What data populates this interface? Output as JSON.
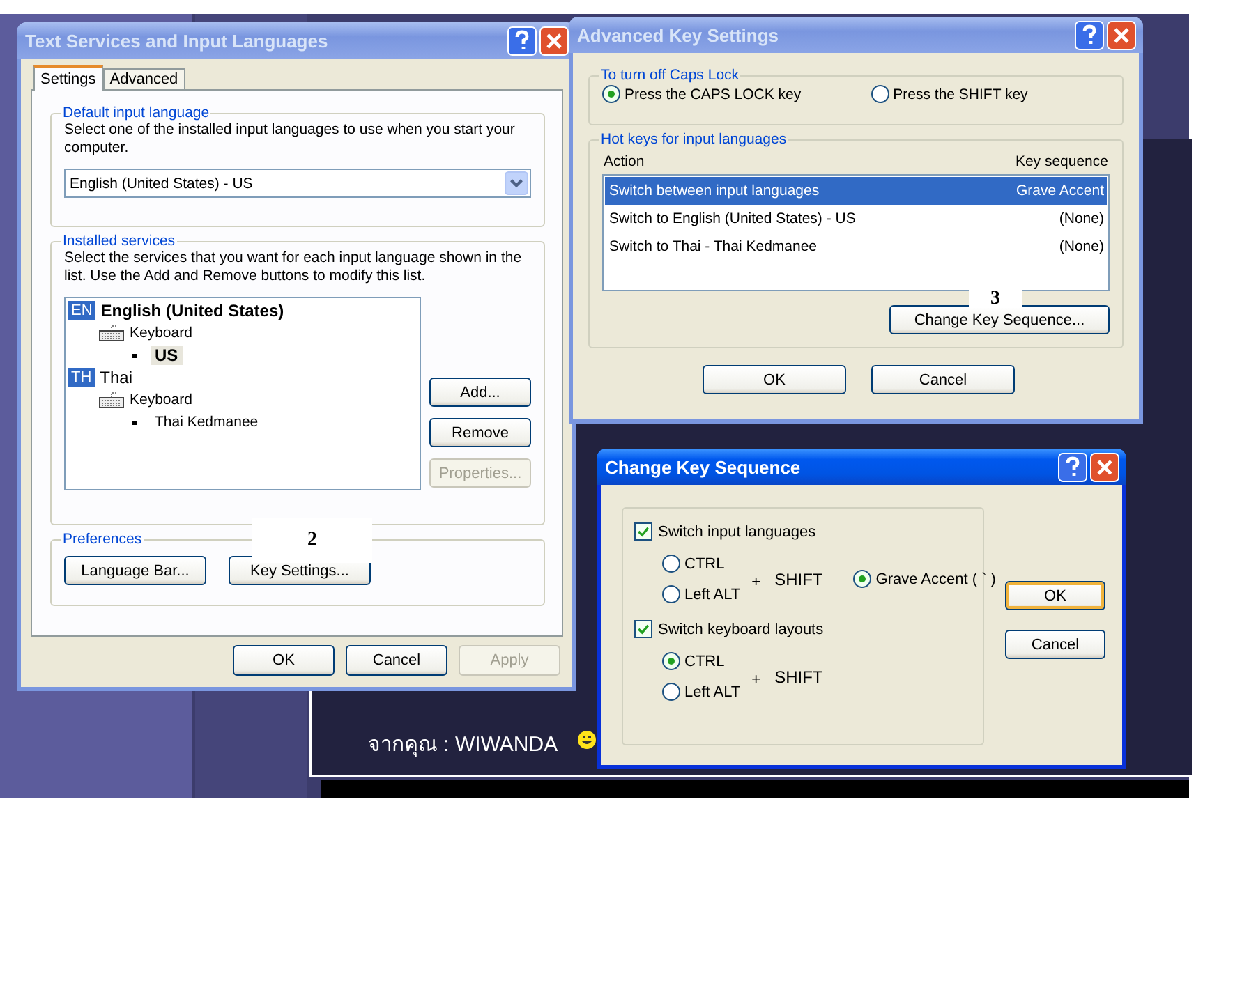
{
  "backdrop": {
    "author_line": "จากคุณ : WIWANDA"
  },
  "text_services": {
    "title": "Text Services and Input Languages",
    "active": false,
    "tabs": [
      {
        "label": "Settings",
        "selected": true
      },
      {
        "label": "Advanced",
        "selected": false
      }
    ],
    "default_group": {
      "legend": "Default input language",
      "description": "Select one of the installed input languages to use when you start your computer.",
      "dropdown": "English (United States) - US"
    },
    "installed_group": {
      "legend": "Installed services",
      "description": "Select the services that you want for each input language shown in the list. Use the Add and Remove buttons to modify this list.",
      "tree": [
        {
          "kind": "language",
          "badge": "EN",
          "label": "English (United States)",
          "default": true,
          "children": [
            {
              "kind": "service",
              "label": "Keyboard",
              "children": [
                {
                  "kind": "layout",
                  "label": "US",
                  "selected": true
                }
              ]
            }
          ]
        },
        {
          "kind": "language",
          "badge": "TH",
          "label": "Thai",
          "default": false,
          "children": [
            {
              "kind": "service",
              "label": "Keyboard",
              "children": [
                {
                  "kind": "layout",
                  "label": "Thai Kedmanee",
                  "selected": false
                }
              ]
            }
          ]
        }
      ],
      "buttons": [
        {
          "label": "Add...",
          "disabled": false
        },
        {
          "label": "Remove",
          "disabled": false
        },
        {
          "label": "Properties...",
          "disabled": true
        }
      ]
    },
    "preferences": {
      "legend": "Preferences",
      "buttons": [
        "Language Bar...",
        "Key Settings..."
      ]
    },
    "footer": [
      {
        "label": "OK",
        "disabled": false
      },
      {
        "label": "Cancel",
        "disabled": false
      },
      {
        "label": "Apply",
        "disabled": true
      }
    ]
  },
  "advanced_key_settings": {
    "title": "Advanced Key Settings",
    "active": false,
    "caps_group": {
      "legend": "To turn off Caps Lock",
      "options": [
        {
          "label": "Press the CAPS LOCK key",
          "selected": true
        },
        {
          "label": "Press the SHIFT key",
          "selected": false
        }
      ]
    },
    "hotkeys_group": {
      "legend": "Hot keys for input languages",
      "columns": [
        "Action",
        "Key sequence"
      ],
      "rows": [
        {
          "action": "Switch between input languages",
          "key": "Grave Accent",
          "selected": true
        },
        {
          "action": "Switch to English (United States) - US",
          "key": "(None)",
          "selected": false
        },
        {
          "action": "Switch to Thai - Thai Kedmanee",
          "key": "(None)",
          "selected": false
        }
      ],
      "change_button": "Change Key Sequence..."
    },
    "footer": [
      "OK",
      "Cancel"
    ]
  },
  "change_key_sequence": {
    "title": "Change Key Sequence",
    "active": true,
    "groups": [
      {
        "label": "Switch input languages",
        "checked": true,
        "options": [
          {
            "label": "CTRL",
            "selected": false
          },
          {
            "label": "Left ALT",
            "selected": false
          }
        ],
        "joiner": "+",
        "key": "SHIFT",
        "alternative": {
          "label": "Grave Accent ( ` )",
          "selected": true
        }
      },
      {
        "label": "Switch keyboard layouts",
        "checked": true,
        "options": [
          {
            "label": "CTRL",
            "selected": true
          },
          {
            "label": "Left ALT",
            "selected": false
          }
        ],
        "joiner": "+",
        "key": "SHIFT"
      }
    ],
    "buttons": [
      {
        "label": "OK",
        "default": true
      },
      {
        "label": "Cancel",
        "default": false
      }
    ]
  },
  "annotations": [
    "2",
    "3"
  ]
}
